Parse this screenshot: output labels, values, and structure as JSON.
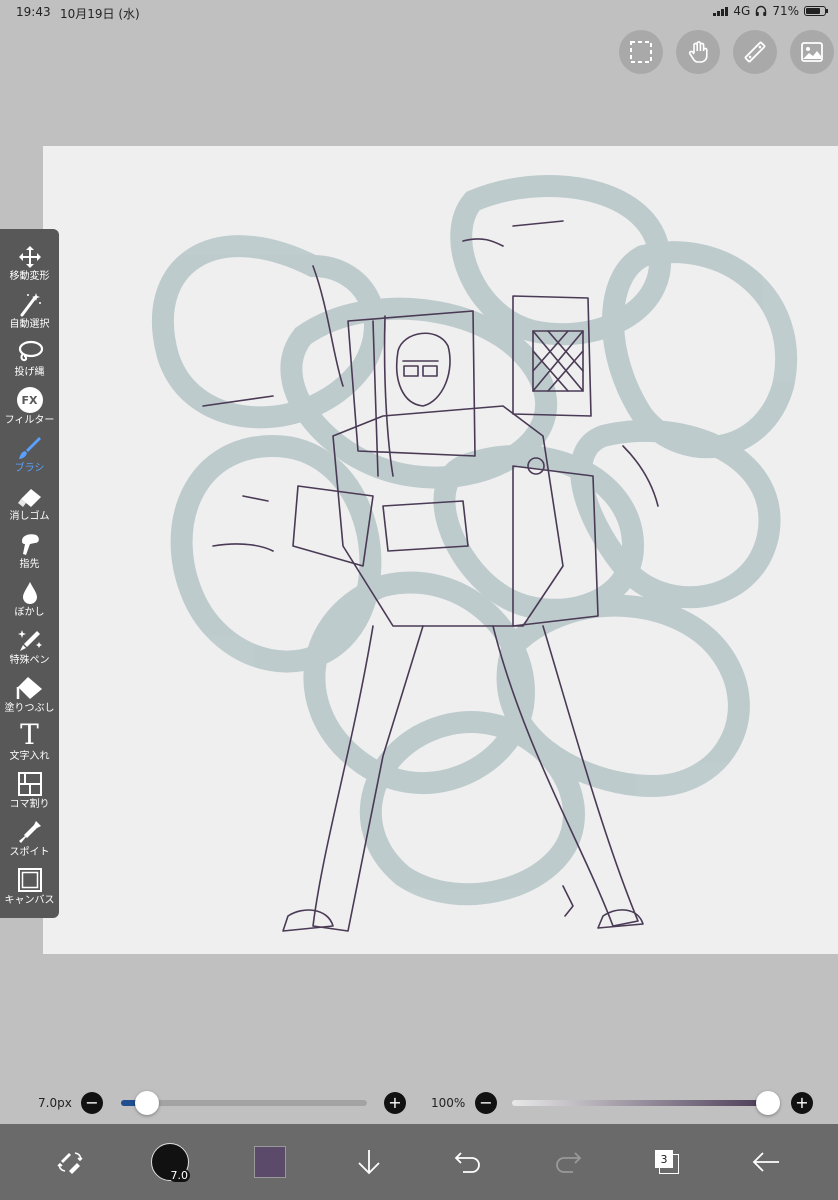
{
  "status": {
    "time": "19:43",
    "date": "10月19日 (水)",
    "network": "4G",
    "battery": "71%"
  },
  "top_buttons": [
    "selection-icon",
    "hand-icon",
    "ruler-icon",
    "image-icon"
  ],
  "tools": [
    {
      "label": "移動変形",
      "icon": "move-icon"
    },
    {
      "label": "自動選択",
      "icon": "magic-wand-icon"
    },
    {
      "label": "投げ縄",
      "icon": "lasso-icon"
    },
    {
      "label": "フィルター",
      "icon": "fx-icon"
    },
    {
      "label": "ブラシ",
      "icon": "brush-icon",
      "active": true
    },
    {
      "label": "消しゴム",
      "icon": "eraser-icon"
    },
    {
      "label": "指先",
      "icon": "finger-icon"
    },
    {
      "label": "ぼかし",
      "icon": "blur-drop-icon"
    },
    {
      "label": "特殊ペン",
      "icon": "special-pen-icon"
    },
    {
      "label": "塗りつぶし",
      "icon": "fill-bucket-icon"
    },
    {
      "label": "文字入れ",
      "icon": "text-icon"
    },
    {
      "label": "コマ割り",
      "icon": "frame-divider-icon"
    },
    {
      "label": "スポイト",
      "icon": "eyedropper-icon"
    },
    {
      "label": "キャンバス",
      "icon": "canvas-icon"
    }
  ],
  "fx_text": "FX",
  "text_tool_glyph": "T",
  "brush_size": {
    "label": "7.0px",
    "value": 7.0
  },
  "opacity": {
    "label": "100%",
    "value": 100
  },
  "bottom": {
    "brush_size_badge": "7.0",
    "layer_count": "3",
    "color": "#5c4a6a"
  }
}
